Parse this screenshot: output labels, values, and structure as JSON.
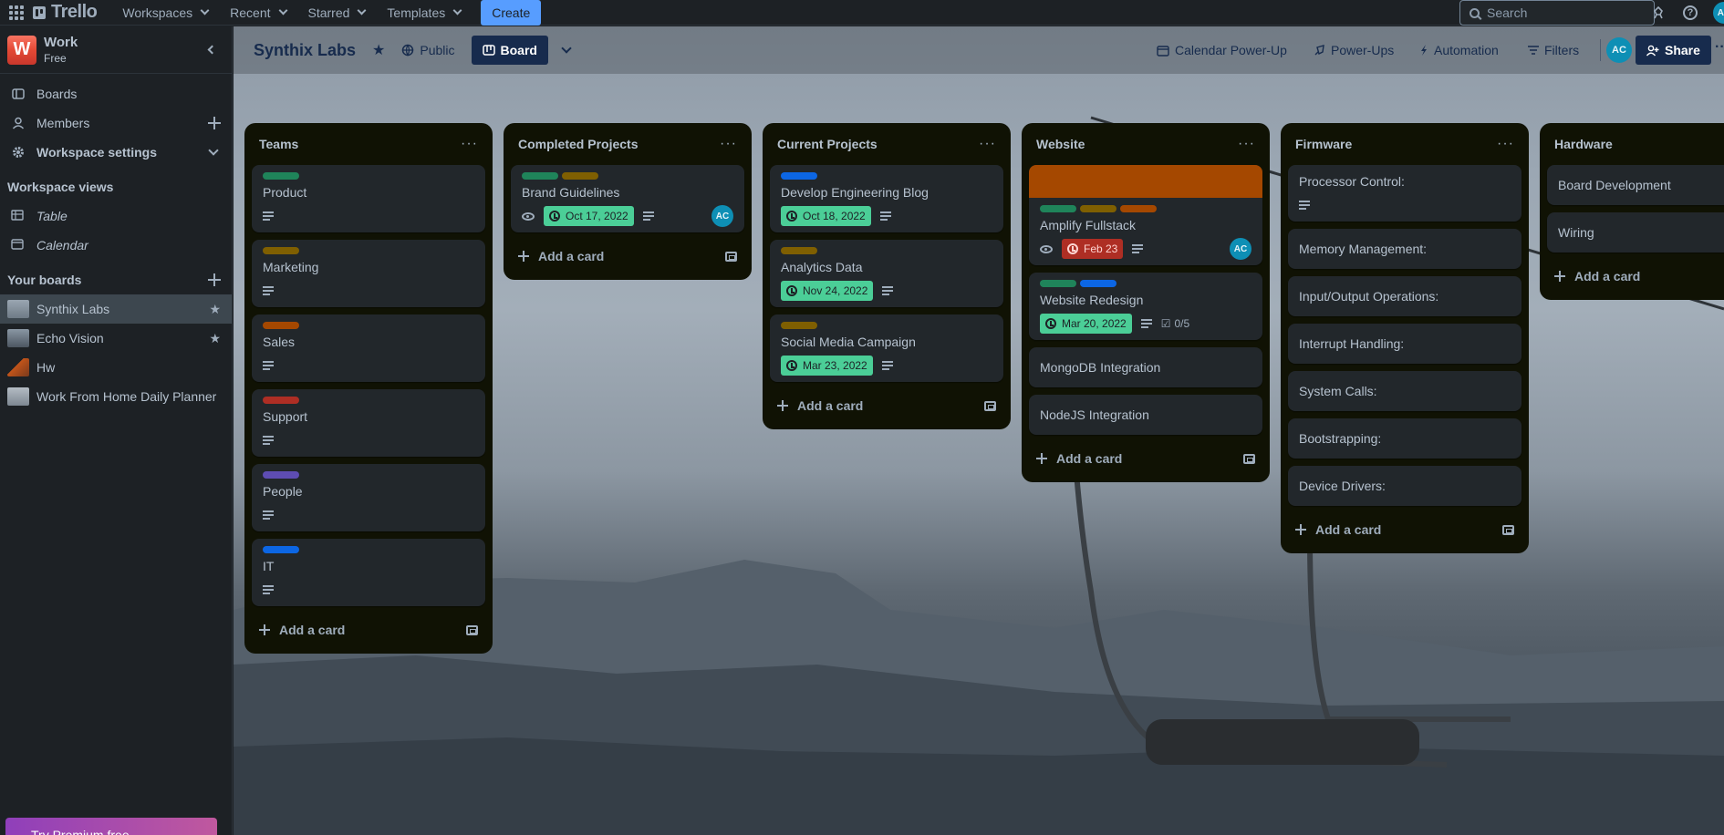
{
  "topbar": {
    "logo": "Trello",
    "nav": [
      "Workspaces",
      "Recent",
      "Starred",
      "Templates"
    ],
    "create": "Create",
    "search_placeholder": "Search"
  },
  "sidebar": {
    "workspace_initial": "W",
    "workspace_name": "Work",
    "workspace_plan": "Free",
    "items": [
      {
        "label": "Boards"
      },
      {
        "label": "Members"
      },
      {
        "label": "Workspace settings"
      }
    ],
    "views_heading": "Workspace views",
    "views": [
      {
        "label": "Table"
      },
      {
        "label": "Calendar"
      }
    ],
    "boards_heading": "Your boards",
    "boards": [
      {
        "label": "Synthix Labs",
        "starred": true,
        "active": true
      },
      {
        "label": "Echo Vision",
        "starred": true,
        "active": false
      },
      {
        "label": "Hw",
        "starred": false,
        "active": false
      },
      {
        "label": "Work From Home Daily Planner",
        "starred": false,
        "active": false
      }
    ],
    "premium": "Try Premium free"
  },
  "board": {
    "title": "Synthix Labs",
    "visibility": "Public",
    "view": "Board",
    "calendar_powerup": "Calendar Power-Up",
    "powerups": "Power-Ups",
    "automation": "Automation",
    "filters": "Filters",
    "member_initials": "AC",
    "share": "Share"
  },
  "lists": [
    {
      "title": "Teams",
      "add_label": "Add a card",
      "cards": [
        {
          "title": "Product",
          "labels": [
            "#1f845a"
          ],
          "desc": true
        },
        {
          "title": "Marketing",
          "labels": [
            "#7f5f01"
          ],
          "desc": true
        },
        {
          "title": "Sales",
          "labels": [
            "#a54800"
          ],
          "desc": true
        },
        {
          "title": "Support",
          "labels": [
            "#ae2e24"
          ],
          "desc": true
        },
        {
          "title": "People",
          "labels": [
            "#5e4db2"
          ],
          "desc": true
        },
        {
          "title": "IT",
          "labels": [
            "#0c66e4"
          ],
          "desc": true
        }
      ]
    },
    {
      "title": "Completed Projects",
      "add_label": "Add a card",
      "cards": [
        {
          "title": "Brand Guidelines",
          "labels": [
            "#1f845a",
            "#7f5f01"
          ],
          "watch": true,
          "due": "Oct 17, 2022",
          "desc": true,
          "member": "AC"
        }
      ]
    },
    {
      "title": "Current Projects",
      "add_label": "Add a card",
      "cards": [
        {
          "title": "Develop Engineering Blog",
          "labels": [
            "#0c66e4"
          ],
          "due": "Oct 18, 2022",
          "desc": true
        },
        {
          "title": "Analytics Data",
          "labels": [
            "#7f5f01"
          ],
          "due": "Nov 24, 2022",
          "desc": true
        },
        {
          "title": "Social Media Campaign",
          "labels": [
            "#7f5f01"
          ],
          "due": "Mar 23, 2022",
          "desc": true
        }
      ]
    },
    {
      "title": "Website",
      "add_label": "Add a card",
      "cards": [
        {
          "title": "Amplify Fullstack",
          "cover": "#a54800",
          "labels": [
            "#1f845a",
            "#7f5f01",
            "#a54800"
          ],
          "watch": true,
          "due": "Feb 23",
          "overdue": true,
          "desc": true,
          "member": "AC"
        },
        {
          "title": "Website Redesign",
          "labels": [
            "#1f845a",
            "#0c66e4"
          ],
          "due": "Mar 20, 2022",
          "desc": true,
          "checklist": "0/5"
        },
        {
          "title": "MongoDB Integration"
        },
        {
          "title": "NodeJS Integration"
        }
      ]
    },
    {
      "title": "Firmware",
      "add_label": "Add a card",
      "cards": [
        {
          "title": "Processor Control:",
          "desc": true
        },
        {
          "title": "Memory Management:"
        },
        {
          "title": "Input/Output Operations:"
        },
        {
          "title": "Interrupt Handling:"
        },
        {
          "title": "System Calls:"
        },
        {
          "title": "Bootstrapping:"
        },
        {
          "title": "Device Drivers:"
        }
      ]
    },
    {
      "title": "Hardware",
      "add_label": "Add a card",
      "cards": [
        {
          "title": "Board Development"
        },
        {
          "title": "Wiring"
        }
      ]
    }
  ]
}
